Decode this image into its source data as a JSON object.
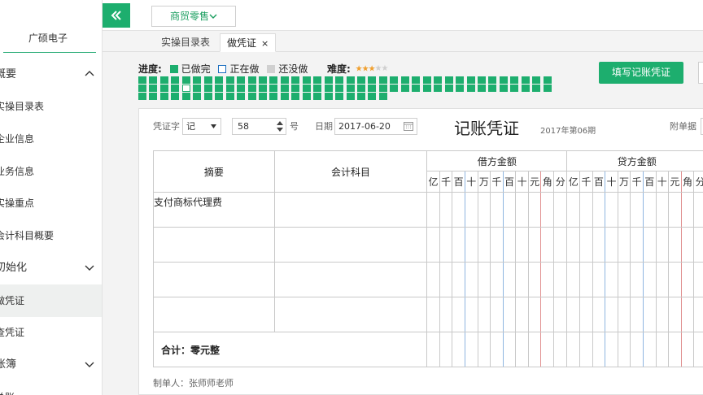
{
  "sidebar": {
    "company": "广硕电子",
    "items": [
      {
        "label": "概要",
        "type": "group",
        "expanded": true
      },
      {
        "label": "实操目录表",
        "type": "sub"
      },
      {
        "label": "企业信息",
        "type": "sub"
      },
      {
        "label": "业务信息",
        "type": "sub"
      },
      {
        "label": "实操重点",
        "type": "sub"
      },
      {
        "label": "会计科目概要",
        "type": "sub"
      },
      {
        "label": "初始化",
        "type": "group",
        "expanded": false
      },
      {
        "label": "做凭证",
        "type": "sub",
        "active": true
      },
      {
        "label": "查凭证",
        "type": "sub"
      },
      {
        "label": "账簿",
        "type": "group",
        "expanded": false
      },
      {
        "label": "总账",
        "type": "sub"
      }
    ]
  },
  "topbar": {
    "collapse_icon": "double-chevron-left-icon",
    "app_selector": "商贸零售"
  },
  "tabs": [
    {
      "label": "实操目录表"
    },
    {
      "label": "做凭证",
      "active": true,
      "close": "×"
    }
  ],
  "progress": {
    "label": "进度:",
    "legend_done": "已做完",
    "legend_doing": "正在做",
    "legend_todo": "还没做",
    "difficulty_label": "难度:",
    "difficulty_stars": 3,
    "difficulty_max": 5,
    "row1_count": 38,
    "row2_count": 38,
    "row3_count": 23,
    "doing_index": 42
  },
  "fill_button": "填写记账凭证",
  "voucher": {
    "word_label": "凭证字",
    "word_value": "记",
    "number_value": "58",
    "number_suffix": "号",
    "date_label": "日期",
    "date_value": "2017-06-20",
    "title": "记账凭证",
    "period": "2017年第06期",
    "attach_label": "附单据",
    "col_summary": "摘要",
    "col_account": "会计科目",
    "col_debit": "借方金额",
    "col_credit": "贷方金额",
    "digits": [
      "亿",
      "千",
      "百",
      "十",
      "万",
      "千",
      "百",
      "十",
      "元",
      "角",
      "分"
    ],
    "rows": [
      {
        "summary": "支付商标代理费",
        "account": ""
      },
      {
        "summary": "",
        "account": ""
      },
      {
        "summary": "",
        "account": ""
      },
      {
        "summary": "",
        "account": ""
      }
    ],
    "total_label": "合计：零元整",
    "preparer": "制单人：张师师老师"
  },
  "colors": {
    "accent": "#1dae6e",
    "border": "#c9c9c9"
  }
}
